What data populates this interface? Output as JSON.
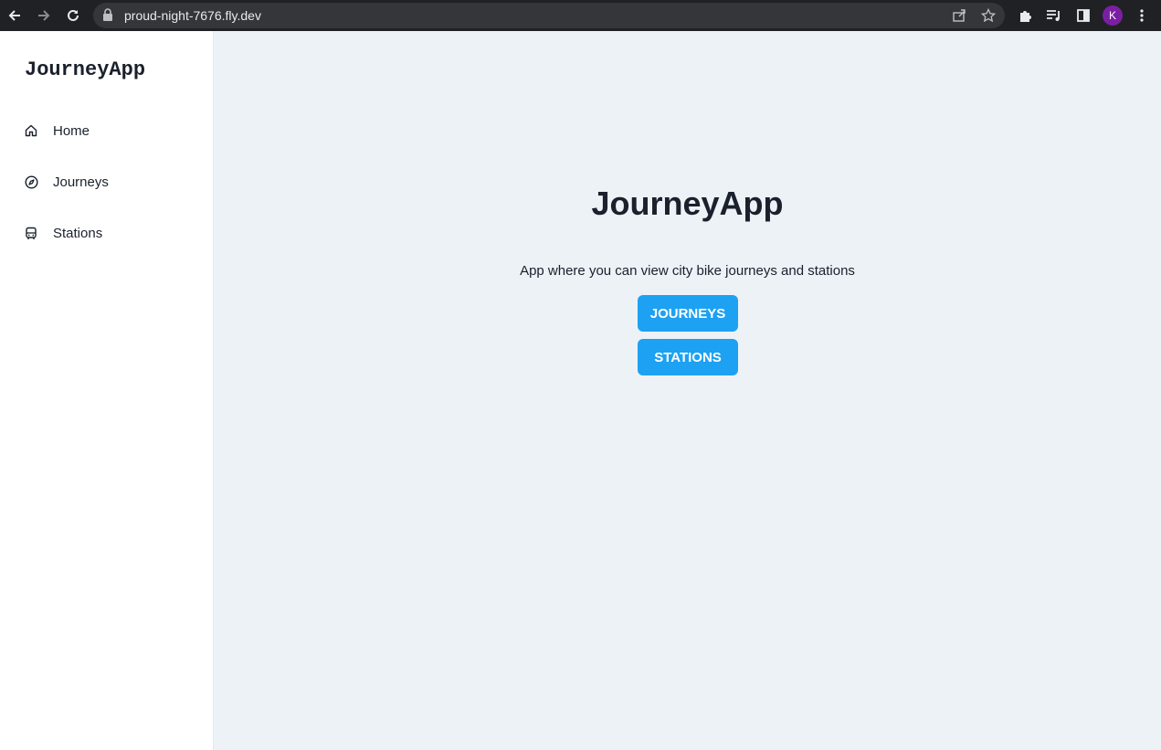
{
  "browser": {
    "url": "proud-night-7676.fly.dev",
    "profile_initial": "K",
    "icons": [
      "back-icon",
      "forward-icon",
      "reload-icon",
      "lock-icon",
      "share-icon",
      "star-icon",
      "extensions-icon",
      "media-icon",
      "side-panel-icon",
      "menu-icon"
    ]
  },
  "sidebar": {
    "brand": "JourneyApp",
    "items": [
      {
        "label": "Home",
        "icon": "home-icon"
      },
      {
        "label": "Journeys",
        "icon": "compass-icon"
      },
      {
        "label": "Stations",
        "icon": "bus-icon"
      }
    ]
  },
  "main": {
    "title": "JourneyApp",
    "subtitle": "App where you can view city bike journeys and stations",
    "buttons": [
      {
        "label": "JOURNEYS"
      },
      {
        "label": "STATIONS"
      }
    ]
  },
  "colors": {
    "accent": "#1da1f2",
    "background": "#edf2f7",
    "text": "#1a202c",
    "chrome": "#202124"
  }
}
